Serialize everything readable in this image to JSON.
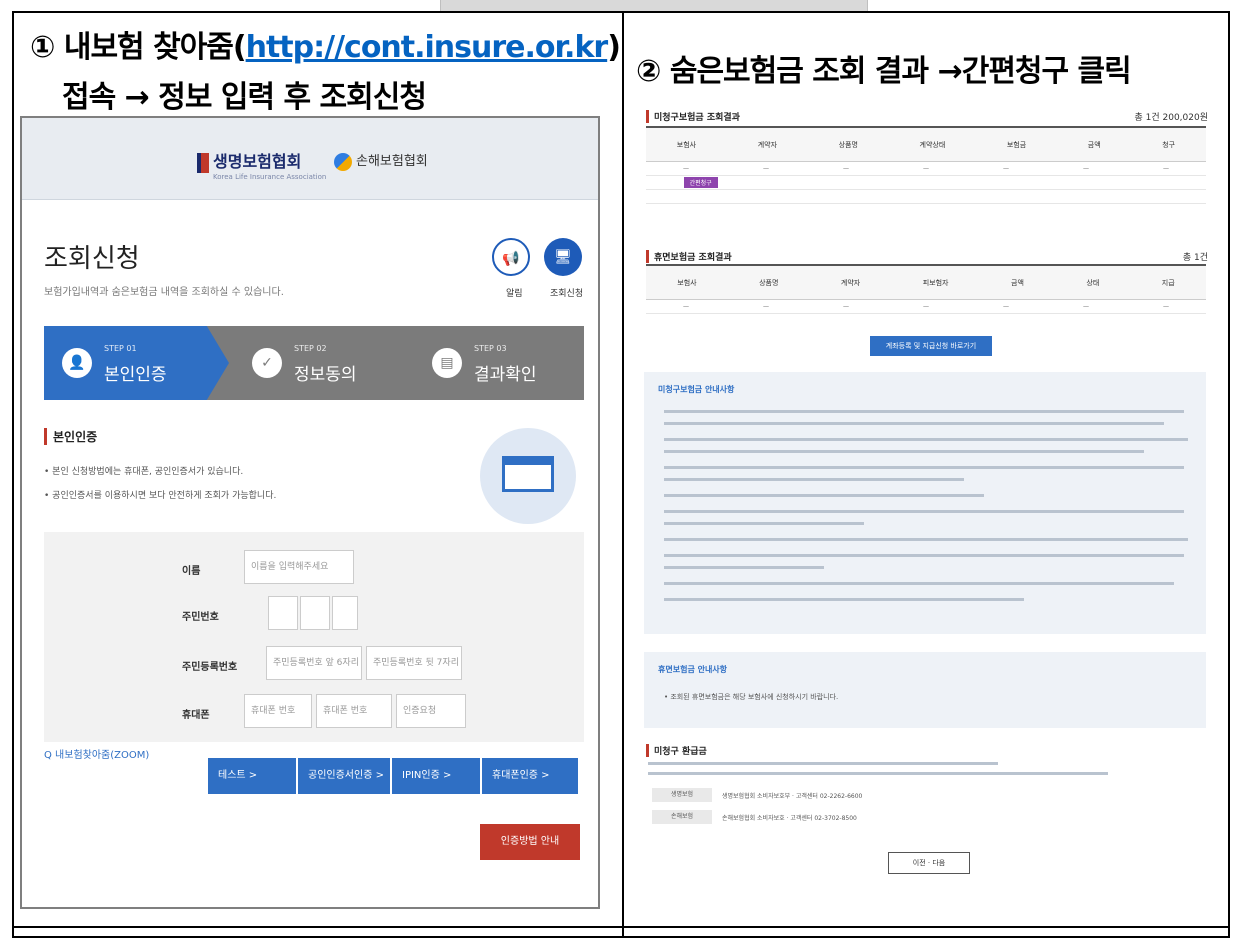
{
  "left": {
    "heading_prefix": "① 내보험 찾아줌(",
    "heading_link": "http://cont.insure.or.kr",
    "heading_suffix": ")",
    "subheading": "접속 → 정보 입력 후 조회신청",
    "site": {
      "logo1": "생명보험협회",
      "logo1_sub": "Korea Life Insurance Association",
      "logo2": "손해보험협회",
      "page_title": "조회신청",
      "page_desc": "보험가입내역과 숨은보험금 내역을 조회하실 수 있습니다.",
      "circle1_label": "알림",
      "circle2_label": "조회신청",
      "steps": [
        {
          "no": "STEP 01",
          "label": "본인인증"
        },
        {
          "no": "STEP 02",
          "label": "정보동의"
        },
        {
          "no": "STEP 03",
          "label": "결과확인"
        }
      ],
      "section_title": "본인인증",
      "bullets": [
        "• 본인 신청방법에는 휴대폰, 공인인증서가 있습니다.",
        "• 공인인증서를 이용하시면 보다 안전하게 조회가 가능합니다."
      ],
      "form": {
        "name_label": "이름",
        "name_placeholder": "이름을 입력해주세요",
        "ssn_label": "주민번호",
        "reg_label": "주민등록번호",
        "reg_ph1": "주민등록번호 앞 6자리",
        "reg_ph2": "주민등록번호 뒷 7자리",
        "phone_label": "휴대폰",
        "phone_ph1": "휴대폰 번호",
        "phone_ph2": "휴대폰 번호",
        "phone_ph3": "인증요청"
      },
      "bottom_brand": "Q 내보험찾아줌(ZOOM)",
      "buttons": [
        "테스트 >",
        "공인인증서인증 >",
        "IPIN인증 >",
        "휴대폰인증 >"
      ],
      "red_button": "인증방법 안내"
    }
  },
  "right": {
    "heading": "② 숨은보험금 조회 결과 →간편청구 클릭",
    "site": {
      "section1_title": "미청구보험금 조회결과",
      "section1_total": "총 1건 200,020원",
      "pill": "간편청구",
      "section2_title": "휴면보험금 조회결과",
      "section2_total": "총 1건",
      "action_button": "계좌등록 및 지급신청 바로가기",
      "notice1_title": "미청구보험금 안내사항",
      "notice2_title": "휴면보험금 안내사항",
      "notice2_text": "• 조회된 휴면보험금은 해당 보험사에 신청하시기 바랍니다.",
      "section3_title": "미청구 환급금",
      "info_rows": [
        {
          "k": "생명보험",
          "v": "생명보험협회 소비자보호부 · 고객센터 02-2262-6600"
        },
        {
          "k": "손해보험",
          "v": "손해보험협회 소비자보호 · 고객센터 02-3702-8500"
        }
      ],
      "pager": "이전   ·   다음"
    }
  },
  "colors": {
    "link": "#0563c1",
    "blue": "#2f6fc4",
    "red": "#c0392b"
  }
}
